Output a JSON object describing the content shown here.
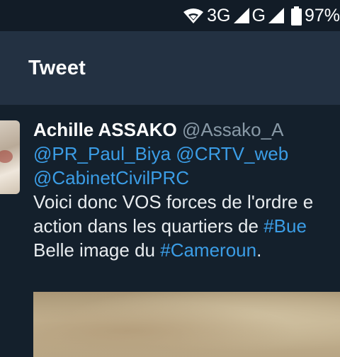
{
  "status_bar": {
    "network_1": "3G",
    "network_2": "G",
    "battery": "97%",
    "icons": [
      "wifi-icon",
      "signal-icon",
      "signal-icon",
      "battery-icon"
    ]
  },
  "app_bar": {
    "title": "Tweet"
  },
  "tweet": {
    "author_name": "Achille ASSAKO",
    "author_handle": "@Assako_A",
    "mention_1": "@PR_Paul_Biya",
    "mention_2": "@CRTV_web",
    "mention_3": "@CabinetCivilPRC",
    "line_1": "Voici donc VOS forces de l'ordre e",
    "line_2_text": "action dans les quartiers de ",
    "hashtag_1": "#Bue",
    "line_3_text": "Belle image du ",
    "hashtag_2": "#Cameroun",
    "line_3_end": "."
  },
  "colors": {
    "background": "#14202c",
    "app_bar": "#233142",
    "link": "#3b9de6",
    "handle": "#8899a6"
  }
}
